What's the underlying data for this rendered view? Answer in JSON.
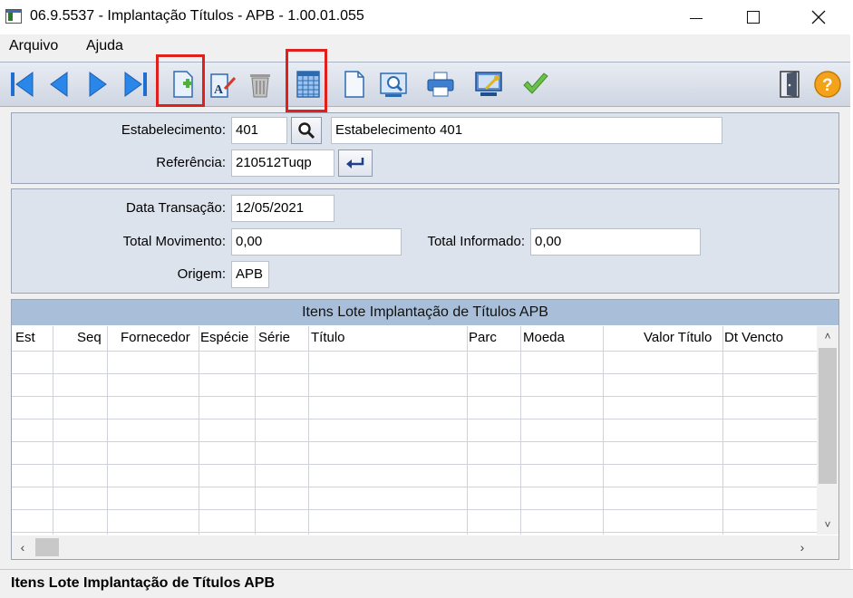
{
  "window": {
    "title": "06.9.5537 - Implantação Títulos - APB - 1.00.01.055"
  },
  "menu": {
    "items": [
      "Arquivo",
      "Ajuda"
    ]
  },
  "toolbar": {
    "buttons": [
      {
        "name": "first-record",
        "icon": "first-icon"
      },
      {
        "name": "previous-record",
        "icon": "previous-icon"
      },
      {
        "name": "next-record",
        "icon": "next-icon"
      },
      {
        "name": "last-record",
        "icon": "last-icon"
      },
      {
        "name": "add-record",
        "icon": "add-document-icon",
        "highlighted": true
      },
      {
        "name": "edit-record",
        "icon": "edit-icon"
      },
      {
        "name": "delete-record",
        "icon": "trash-icon"
      },
      {
        "name": "grid-view",
        "icon": "grid-icon",
        "highlighted": true
      },
      {
        "name": "new-document",
        "icon": "document-icon"
      },
      {
        "name": "preview",
        "icon": "preview-icon"
      },
      {
        "name": "print",
        "icon": "printer-icon"
      },
      {
        "name": "configure",
        "icon": "computer-key-icon"
      },
      {
        "name": "confirm",
        "icon": "checkmark-icon"
      },
      {
        "name": "exit",
        "icon": "exit-door-icon"
      },
      {
        "name": "help",
        "icon": "help-icon"
      }
    ],
    "highlight_color": "#e0201c"
  },
  "header_form": {
    "estabelecimento_label": "Estabelecimento:",
    "estabelecimento_value": "401",
    "estabelecimento_desc": "Estabelecimento 401",
    "referencia_label": "Referência:",
    "referencia_value": "210512Tuqp"
  },
  "transaction_form": {
    "data_transacao_label": "Data Transação:",
    "data_transacao_value": "12/05/2021",
    "total_movimento_label": "Total  Movimento:",
    "total_movimento_value": "0,00",
    "total_informado_label": "Total Informado:",
    "total_informado_value": "0,00",
    "origem_label": "Origem:",
    "origem_value": "APB"
  },
  "grid": {
    "caption": "Itens Lote Implantação de Títulos APB",
    "columns": [
      "Est",
      "Seq",
      "Fornecedor",
      "Espécie",
      "Série",
      "Título",
      "Parc",
      "Moeda",
      "Valor Título",
      "Dt Vencto"
    ],
    "rows": []
  },
  "status": {
    "text": "Itens Lote Implantação de Títulos APB"
  },
  "colors": {
    "panel_bg": "#dde3ed",
    "grid_caption_bg": "#a9bfd9",
    "toolbar_bg": "#cfd6e2"
  }
}
